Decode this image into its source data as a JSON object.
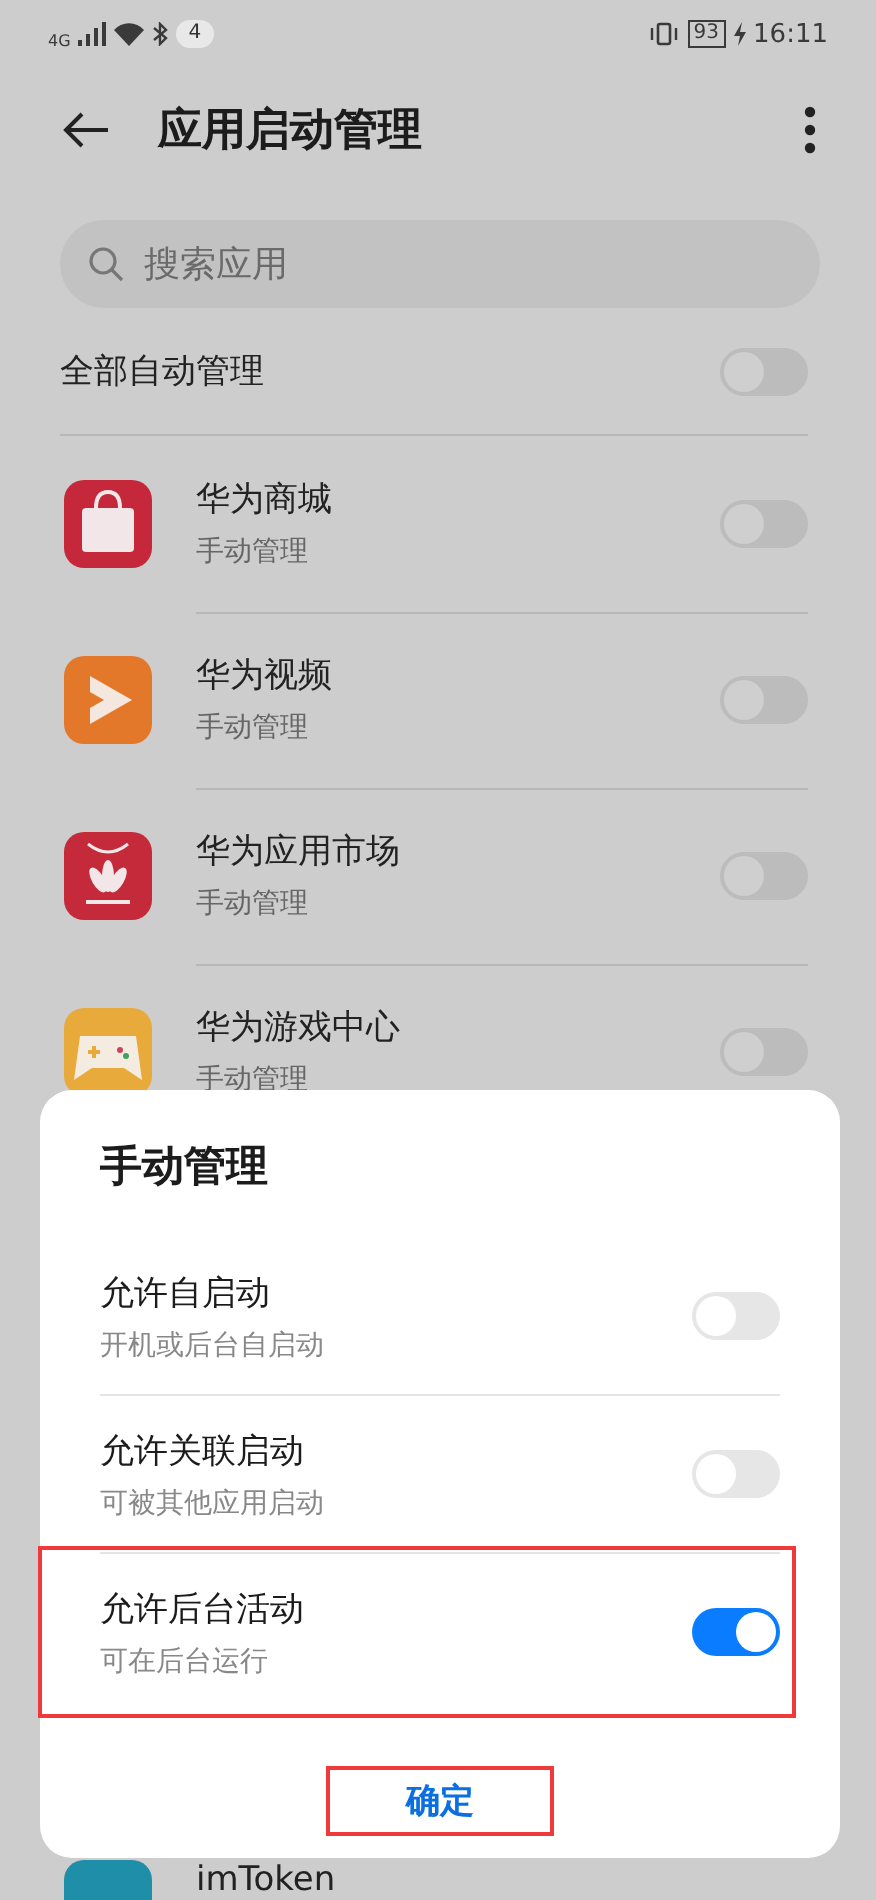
{
  "status_bar": {
    "network": "4G",
    "notification_count": "4",
    "battery": "93",
    "time": "16:11"
  },
  "header": {
    "title": "应用启动管理"
  },
  "search": {
    "placeholder": "搜索应用"
  },
  "all_auto": {
    "label": "全部自动管理",
    "on": false
  },
  "apps": [
    {
      "name": "华为商城",
      "status": "手动管理",
      "on": false
    },
    {
      "name": "华为视频",
      "status": "手动管理",
      "on": false
    },
    {
      "name": "华为应用市场",
      "status": "手动管理",
      "on": false
    },
    {
      "name": "华为游戏中心",
      "status": "手动管理",
      "on": false
    }
  ],
  "last_app": {
    "name": "imToken"
  },
  "dialog": {
    "title": "手动管理",
    "options": [
      {
        "label": "允许自启动",
        "hint": "开机或后台自启动",
        "on": false,
        "highlighted": false
      },
      {
        "label": "允许关联启动",
        "hint": "可被其他应用启动",
        "on": false,
        "highlighted": false
      },
      {
        "label": "允许后台活动",
        "hint": "可在后台运行",
        "on": true,
        "highlighted": true
      }
    ],
    "confirm": {
      "label": "确定",
      "highlighted": true
    }
  }
}
